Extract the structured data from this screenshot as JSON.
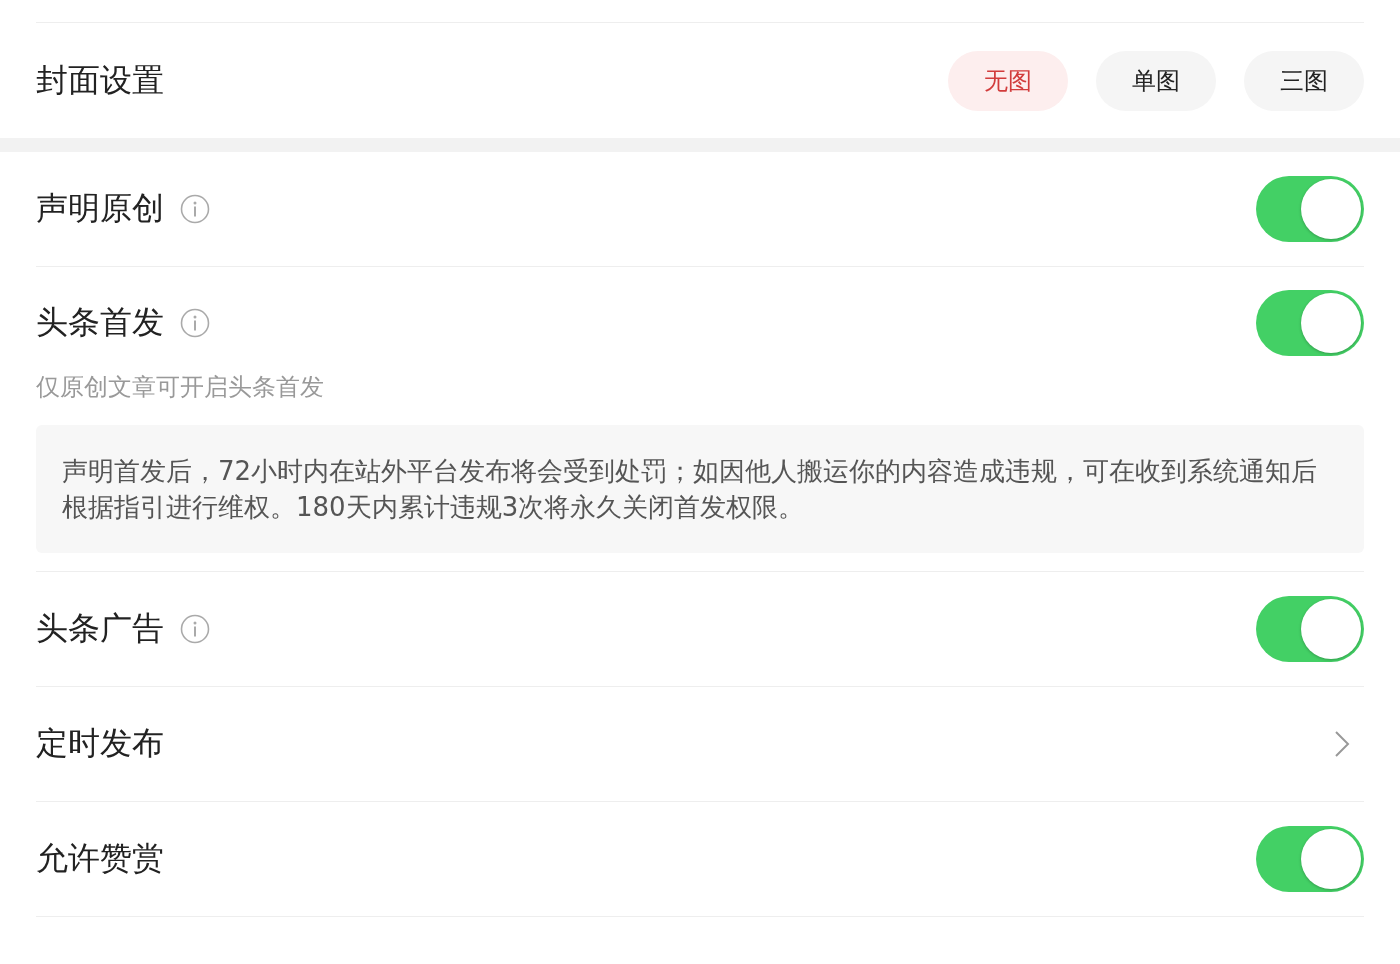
{
  "cover": {
    "label": "封面设置",
    "options": [
      {
        "label": "无图",
        "selected": true
      },
      {
        "label": "单图",
        "selected": false
      },
      {
        "label": "三图",
        "selected": false
      }
    ]
  },
  "settings": [
    {
      "kind": "toggle",
      "label": "声明原创",
      "info": true,
      "on": true
    },
    {
      "kind": "toggle",
      "label": "头条首发",
      "info": true,
      "on": true,
      "hint": "仅原创文章可开启头条首发",
      "notice": "声明首发后，72小时内在站外平台发布将会受到处罚；如因他人搬运你的内容造成违规，可在收到系统通知后根据指引进行维权。180天内累计违规3次将永久关闭首发权限。"
    },
    {
      "kind": "toggle",
      "label": "头条广告",
      "info": true,
      "on": true
    },
    {
      "kind": "chevron",
      "label": "定时发布",
      "info": false
    },
    {
      "kind": "toggle",
      "label": "允许赞赏",
      "info": false,
      "on": true
    }
  ]
}
